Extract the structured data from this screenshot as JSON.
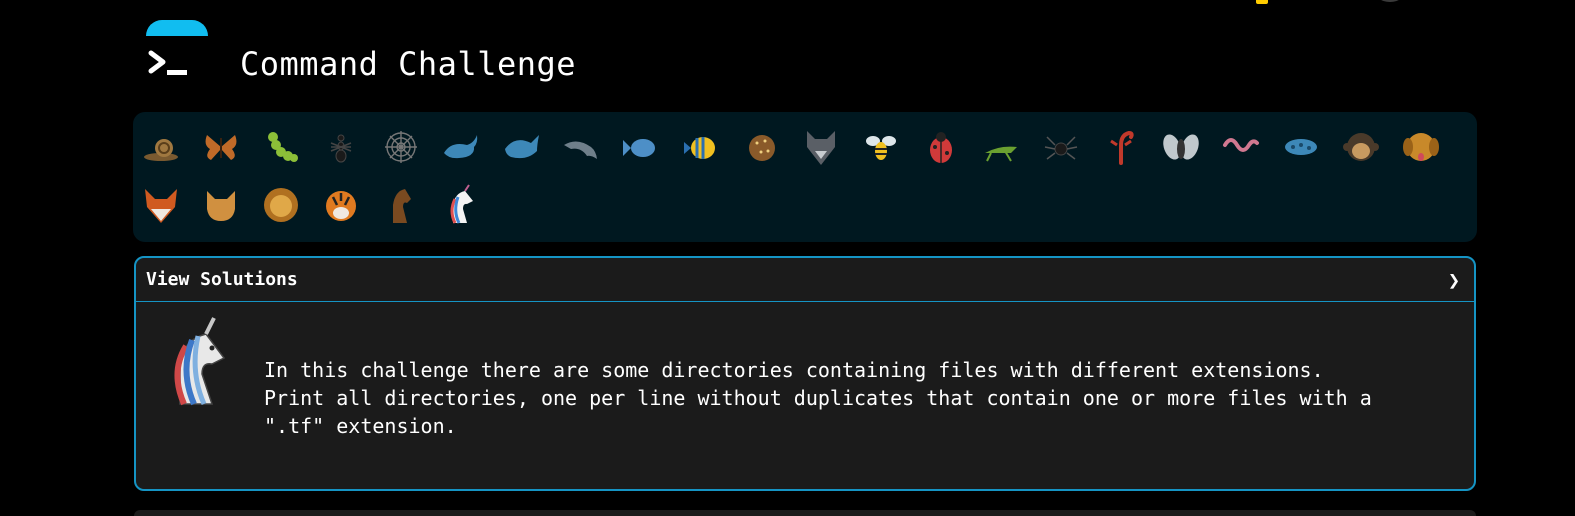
{
  "app": {
    "title": "Command Challenge",
    "accent_color": "#11bdf0",
    "border_color": "#1594c4"
  },
  "critters": {
    "row1": [
      "snail-icon",
      "butterfly-icon",
      "caterpillar-icon",
      "ant-icon",
      "spider-web-icon",
      "whale-icon",
      "shark-icon",
      "dolphin-icon",
      "fish-icon",
      "tropical-fish-icon",
      "blowfish-icon",
      "wolf-icon",
      "bee-icon",
      "ladybug-icon",
      "cricket-icon",
      "spider-icon",
      "scorpion-icon",
      "fly-icon",
      "worm-icon",
      "microbe-icon",
      "monkey-icon",
      "dog-icon"
    ],
    "row2": [
      "fox-icon",
      "cat-icon",
      "lion-icon",
      "tiger-icon",
      "horse-icon",
      "unicorn-icon"
    ]
  },
  "panel": {
    "header_label": "View Solutions",
    "chevron": "❯",
    "description": "In this challenge there are some directories containing files with different extensions.\nPrint all directories, one per line without duplicates that contain one or more files with a\n\".tf\" extension."
  }
}
